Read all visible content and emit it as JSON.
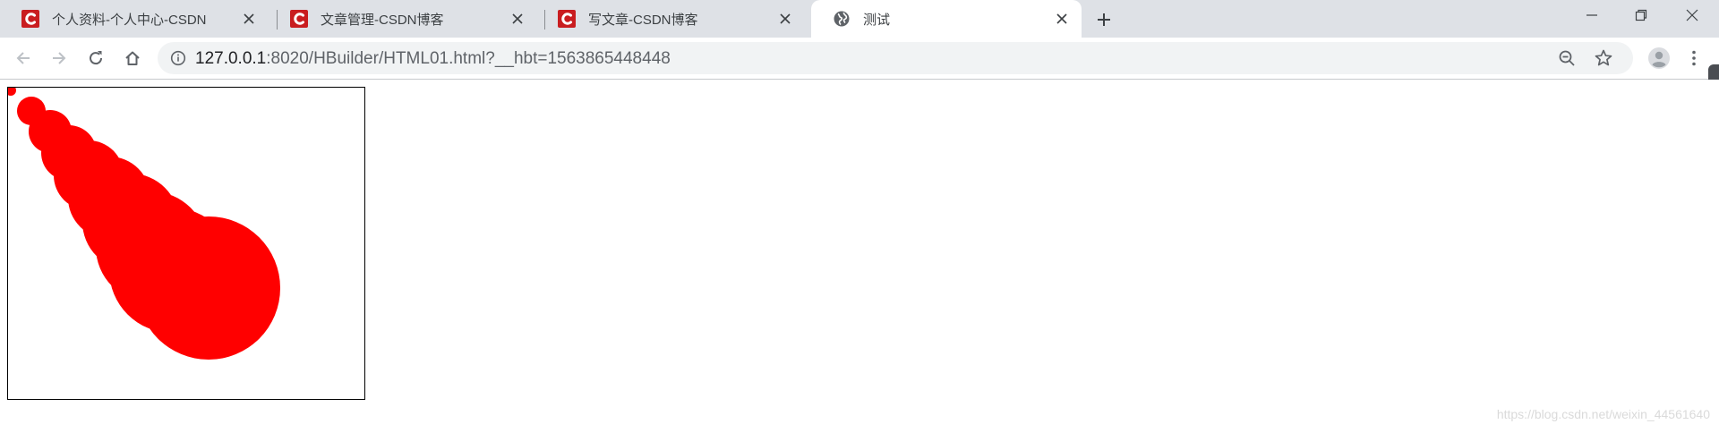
{
  "tabs": [
    {
      "title": "个人资料-个人中心-CSDN",
      "icon": "csdn-logo-icon",
      "active": false
    },
    {
      "title": "文章管理-CSDN博客",
      "icon": "csdn-logo-icon",
      "active": false
    },
    {
      "title": "写文章-CSDN博客",
      "icon": "csdn-logo-icon",
      "active": false
    },
    {
      "title": "测试",
      "icon": "globe-icon",
      "active": true
    }
  ],
  "address_bar": {
    "host": "127.0.0.1",
    "rest": ":8020/HBuilder/HTML01.html?__hbt=1563865448448"
  },
  "page": {
    "watermark": "https://blog.csdn.net/weixin_44561640"
  },
  "colors": {
    "brand_csdn": "#c91d20",
    "ball": "#ff0000",
    "tabstrip": "#dee1e6",
    "omnibox": "#f1f3f4"
  }
}
